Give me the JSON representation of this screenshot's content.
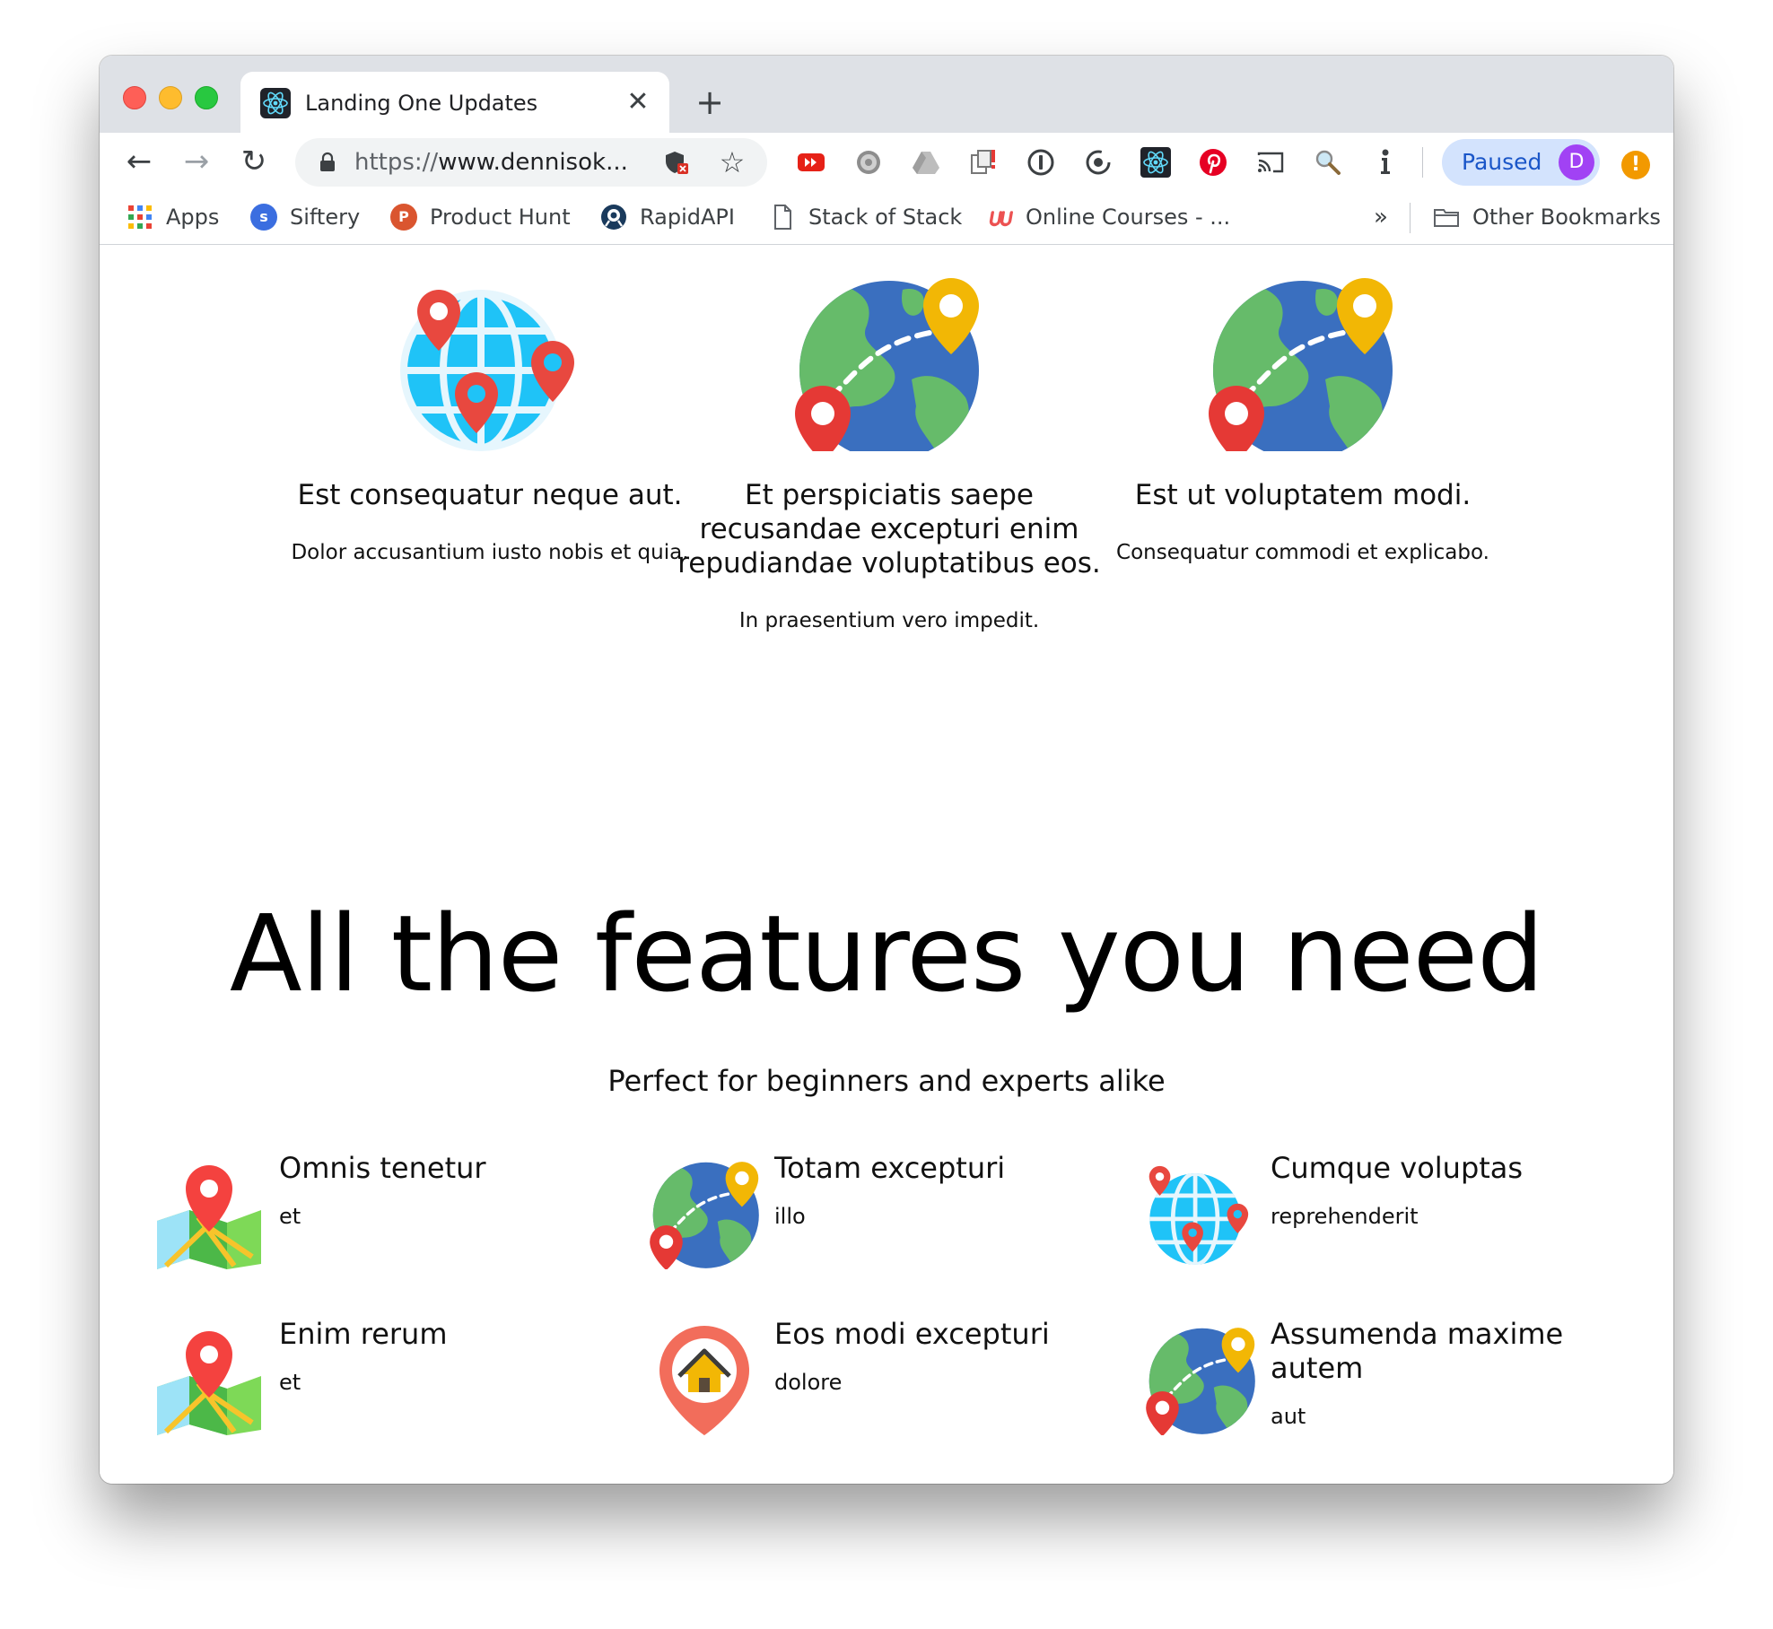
{
  "browser": {
    "tab_title": "Landing One Updates",
    "tab_close": "✕",
    "new_tab": "+",
    "url_scheme": "https://",
    "url_rest": "www.dennisok...",
    "profile_label": "Paused",
    "profile_initial": "D",
    "update_glyph": "!",
    "back": "←",
    "forward": "→",
    "reload": "↻",
    "star": "☆",
    "more_bookmarks": "»"
  },
  "bookmarks": [
    {
      "label": "Apps"
    },
    {
      "label": "Siftery",
      "icon_letter": "s"
    },
    {
      "label": "Product Hunt",
      "icon_letter": "P"
    },
    {
      "label": "RapidAPI"
    },
    {
      "label": "Stack of Stack"
    },
    {
      "label": "Online Courses - ..."
    },
    {
      "label": "Other Bookmarks"
    }
  ],
  "cards": [
    {
      "title": "Est consequatur neque aut.",
      "text": "Dolor accusantium iusto nobis et quia.",
      "icon": "globe-pins-icon"
    },
    {
      "title": "Et perspiciatis saepe recusandae excepturi enim repudiandae voluptatibus eos.",
      "text": "In praesentium vero impedit.",
      "icon": "earth-route-icon"
    },
    {
      "title": "Est ut voluptatem modi.",
      "text": "Consequatur commodi et explicabo.",
      "icon": "earth-route-icon"
    }
  ],
  "features": {
    "heading": "All the features you need",
    "subheading": "Perfect for beginners and experts alike",
    "items": [
      {
        "title": "Omnis tenetur",
        "desc": "et",
        "icon": "map-pin-icon"
      },
      {
        "title": "Totam excepturi",
        "desc": "illo",
        "icon": "earth-route-icon"
      },
      {
        "title": "Cumque voluptas",
        "desc": "reprehenderit",
        "icon": "globe-pins-icon"
      },
      {
        "title": "Enim rerum",
        "desc": "et",
        "icon": "map-pin-icon"
      },
      {
        "title": "Eos modi excepturi",
        "desc": "dolore",
        "icon": "home-pin-icon"
      },
      {
        "title": "Assumenda maxime autem",
        "desc": "aut",
        "icon": "earth-route-icon"
      }
    ]
  },
  "colors": {
    "globe_blue": "#1fc3f7",
    "pin_red": "#e8483f",
    "pin_yellow": "#f2b705",
    "earth_ocean": "#3a6fbf",
    "earth_land": "#66bb6a"
  }
}
